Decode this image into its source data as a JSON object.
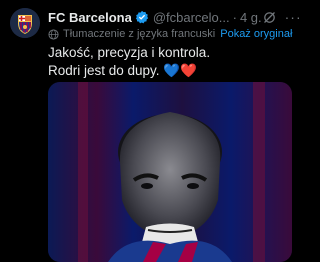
{
  "post": {
    "author_name": "FC Barcelona",
    "handle": "@fcbarcelo...",
    "separator": "·",
    "time": "4 g.",
    "more_glyph": "···",
    "translation_label": "Tłumaczenie z języka francuski",
    "show_original_label": "Pokaż oryginał",
    "text_line_1": "Jakość, precyzja i kontrola.",
    "text_line_2": "Rodri jest do dupy.",
    "hearts": "💙❤️"
  },
  "colors": {
    "background": "#000000",
    "text": "#e7e9ea",
    "muted": "#71767b",
    "link": "#1d9bf0",
    "barca_blue": "#1a3a8f",
    "barca_red": "#a50044"
  },
  "icons": [
    "barcelona-crest-avatar",
    "verified-badge-icon",
    "grok-icon",
    "more-icon",
    "globe-icon"
  ]
}
